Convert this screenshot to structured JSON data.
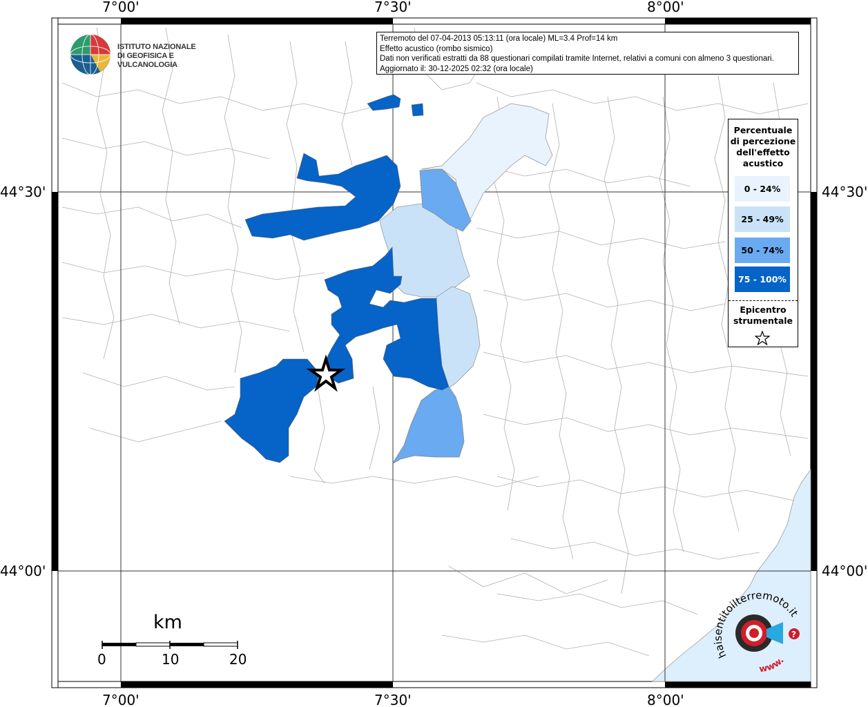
{
  "map": {
    "axes": {
      "top_labels": [
        "7°00'",
        "7°30'",
        "8°00'"
      ],
      "bottom_labels": [
        "7°00'",
        "7°30'",
        "8°00'"
      ],
      "left_labels": [
        "44°30'",
        "44°00'"
      ],
      "right_labels": [
        "44°30'",
        "44°00'"
      ]
    },
    "colors": {
      "class_0_24": "#e8f3fd",
      "class_25_49": "#c9e2f8",
      "class_50_74": "#6aaaf0",
      "class_75_100": "#0663c7",
      "sea": "#ddeefc",
      "border": "#a6a6a6"
    }
  },
  "header_info": {
    "line1": "Terremoto del 07-04-2013 05:13:11 (ora locale) ML=3.4 Prof=14 km",
    "line2": "Effetto acustico (rombo sismico)",
    "line3": "Dati non verificati estratti da 88 questionari compilati tramite Internet, relativi a comuni con almeno 3 questionari.",
    "line4": "Aggiornato il: 30-12-2025 02:32 (ora locale)"
  },
  "institute": {
    "line1": "ISTITUTO NAZIONALE",
    "line2": "DI GEOFISICA E VULCANOLOGIA"
  },
  "legend": {
    "title_lines": [
      "Percentuale",
      "di percezione",
      "dell'effetto",
      "acustico"
    ],
    "items": [
      {
        "label": "0 - 24%",
        "color": "#e8f3fd"
      },
      {
        "label": "25 - 49%",
        "color": "#c9e2f8"
      },
      {
        "label": "50 - 74%",
        "color": "#6aaaf0"
      },
      {
        "label": "75 - 100%",
        "color": "#0663c7"
      }
    ],
    "epicenter_lines": [
      "Epicentro",
      "strumentale"
    ]
  },
  "scale_bar": {
    "unit": "km",
    "labels": [
      "0",
      "10",
      "20"
    ]
  },
  "website_logo": {
    "text_top": "haisentitoilterremoto.it",
    "text_bottom": "www.",
    "question": "?"
  }
}
